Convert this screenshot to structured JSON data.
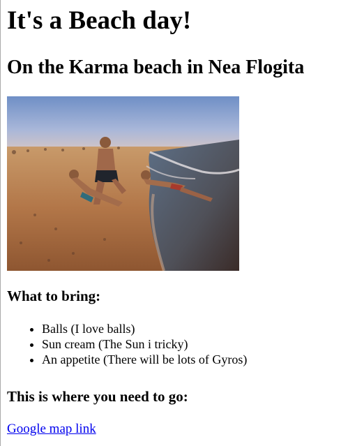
{
  "heading": {
    "title": "It's a Beach day!",
    "subtitle": "On the Karma beach in Nea Flogita"
  },
  "photo": {
    "description_icon": "beach-photo"
  },
  "bring": {
    "heading": "What to bring:",
    "items": [
      "Balls (I love balls)",
      "Sun cream (The Sun i tricky)",
      "An appetite (There will be lots of Gyros)"
    ]
  },
  "directions": {
    "heading": "This is where you need to go:",
    "link_text": "Google map link"
  },
  "colors": {
    "link": "#0000ee",
    "text": "#000000",
    "background": "#ffffff"
  }
}
